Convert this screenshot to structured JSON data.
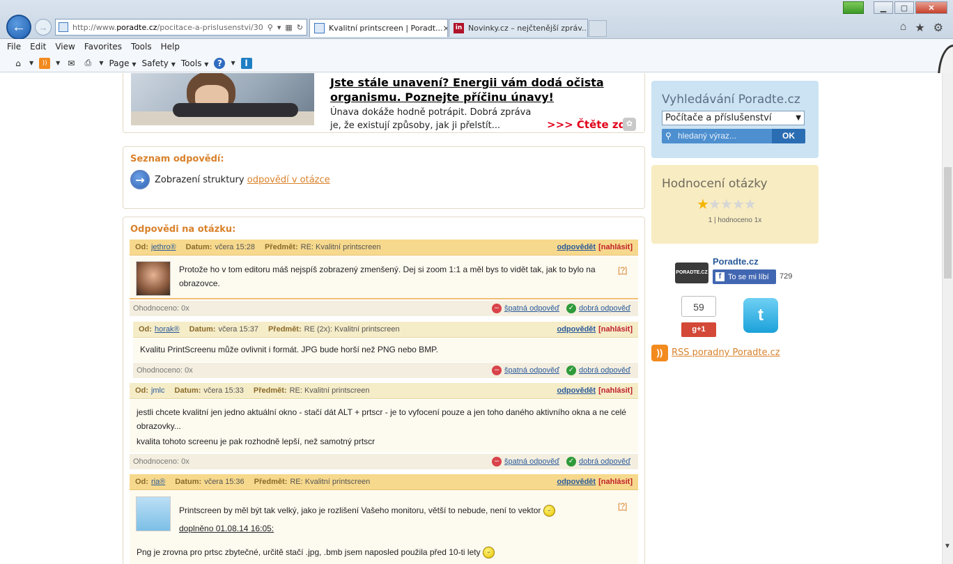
{
  "browser": {
    "url_prefix": "http://www.",
    "url_domain": "poradte.cz",
    "url_path": "/pocitace-a-prislusenstvi/30",
    "tabs": [
      {
        "label": "Kvalitní printscreen | Poradt...",
        "close": "✕"
      },
      {
        "label": "Novinky.cz – nejčtenější zpráv..."
      }
    ],
    "menu": [
      "File",
      "Edit",
      "View",
      "Favorites",
      "Tools",
      "Help"
    ],
    "commands": {
      "page": "Page",
      "safety": "Safety",
      "tools": "Tools"
    },
    "colors": {
      "chrome": "#d3dfeb",
      "accent": "#2f6bc0"
    }
  },
  "ad": {
    "title": "Jste stále unavení? Energii vám dodá očista organismu. Poznejte příčinu únavy!",
    "text": "Únava dokáže hodně potrápit. Dobrá zpráva je, že existují způsoby, jak ji přelstít...",
    "more": ">>> Čtěte zde"
  },
  "structure": {
    "title": "Seznam odpovědí:",
    "text": "Zobrazení struktury",
    "link": "odpovědí v otázce"
  },
  "answers_title": "Odpovědi na otázku:",
  "labels": {
    "from": "Od:",
    "date": "Datum:",
    "subject": "Předmět:",
    "reply": "odpovědět",
    "report": "[nahlásit]",
    "bad": "špatná odpověď",
    "good": "dobrá odpověď",
    "qmark": "[?]"
  },
  "answers": [
    {
      "user": "jethro®",
      "date": "včera 15:28",
      "subject": "RE: Kvalitní printscreen",
      "text": "Protože ho v tom editoru máš nejspíš zobrazený zmenšený. Dej si zoom 1:1 a měl bys to vidět tak, jak to bylo na obrazovce.",
      "rating": "Ohodnoceno: 0x"
    },
    {
      "user": "horak®",
      "date": "včera 15:37",
      "subject": "RE (2x): Kvalitní printscreen",
      "text": "Kvalitu PrintScreenu může ovlivnit i formát. JPG bude horší než PNG nebo BMP.",
      "rating": "Ohodnoceno: 0x"
    },
    {
      "user": "jmlc",
      "date": "včera 15:33",
      "subject": "RE: Kvalitní printscreen",
      "text": "jestli chcete kvalitní jen jedno aktuální okno - stačí dát ALT + prtscr - je to vyfocení pouze a jen toho daného aktivního okna a ne celé obrazovky...",
      "text2": "kvalita tohoto screenu je pak rozhodně lepší, než samotný prtscr",
      "rating": "Ohodnoceno: 0x"
    },
    {
      "user": "ria®",
      "date": "včera 15:36",
      "subject": "RE: Kvalitní printscreen",
      "text": "Printscreen by měl být tak velký, jako je rozlišení Vašeho monitoru, větší to nebude, není to vektor",
      "added": "doplněno 01.08.14 16:05:",
      "text2": "Png je zrovna pro prtsc zbytečné, určitě stačí .jpg, .bmb jsem naposled použila před 10-ti lety"
    }
  ],
  "sidebar": {
    "search_title": "Vyhledávání Poradte.cz",
    "search_category": "Počítače a příslušenství",
    "search_placeholder": "hledaný výraz...",
    "search_ok": "OK",
    "rating_title": "Hodnocení otázky",
    "rating_value": 1,
    "rating_max": 5,
    "rating_text": "1 | hodnoceno 1x",
    "social_name": "Poradte.cz",
    "fb_label": "To se mi líbí",
    "fb_count": "729",
    "gplus_count": "59",
    "gplus_label": "g+1",
    "rss_text": "RSS poradny Poradte.cz"
  }
}
